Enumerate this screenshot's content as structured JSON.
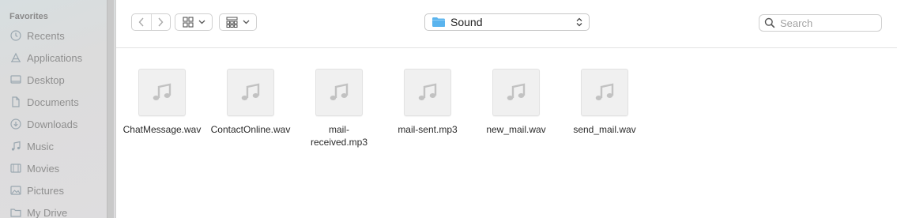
{
  "sidebar": {
    "heading": "Favorites",
    "items": [
      {
        "label": "Recents",
        "icon": "clock-icon"
      },
      {
        "label": "Applications",
        "icon": "applications-icon"
      },
      {
        "label": "Desktop",
        "icon": "desktop-icon"
      },
      {
        "label": "Documents",
        "icon": "document-icon"
      },
      {
        "label": "Downloads",
        "icon": "download-icon"
      },
      {
        "label": "Music",
        "icon": "music-note-icon"
      },
      {
        "label": "Movies",
        "icon": "film-icon"
      },
      {
        "label": "Pictures",
        "icon": "photo-icon"
      },
      {
        "label": "My Drive",
        "icon": "folder-icon"
      }
    ]
  },
  "toolbar": {
    "path_folder": "Sound",
    "search_placeholder": "Search"
  },
  "files": [
    {
      "name": "ChatMessage.wav",
      "icon": "audio-file-icon"
    },
    {
      "name": "ContactOnline.wav",
      "icon": "audio-file-icon"
    },
    {
      "name": "mail-received.mp3",
      "icon": "audio-file-icon"
    },
    {
      "name": "mail-sent.mp3",
      "icon": "audio-file-icon"
    },
    {
      "name": "new_mail.wav",
      "icon": "audio-file-icon"
    },
    {
      "name": "send_mail.wav",
      "icon": "audio-file-icon"
    }
  ],
  "colors": {
    "sidebar_text": "#8f8f8f",
    "folder_blue": "#5ab4ee",
    "icon_gray": "#c2c2c2"
  }
}
